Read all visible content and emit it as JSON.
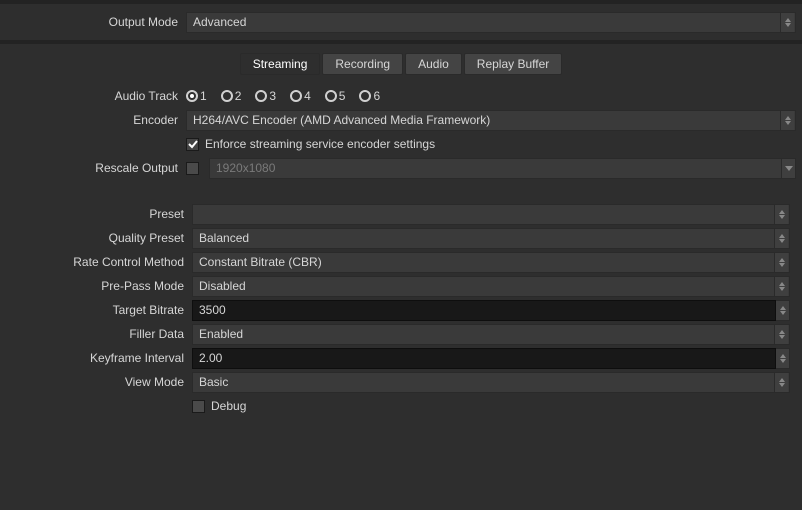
{
  "labels": {
    "output_mode": "Output Mode",
    "audio_track": "Audio Track",
    "encoder": "Encoder",
    "rescale_output": "Rescale Output",
    "preset": "Preset",
    "quality_preset": "Quality Preset",
    "rate_control_method": "Rate Control Method",
    "pre_pass_mode": "Pre-Pass Mode",
    "target_bitrate": "Target Bitrate",
    "filler_data": "Filler Data",
    "keyframe_interval": "Keyframe Interval",
    "view_mode": "View Mode"
  },
  "output_mode_value": "Advanced",
  "tabs": {
    "streaming": "Streaming",
    "recording": "Recording",
    "audio": "Audio",
    "replay_buffer": "Replay Buffer"
  },
  "audio_tracks": {
    "t1": "1",
    "t2": "2",
    "t3": "3",
    "t4": "4",
    "t5": "5",
    "t6": "6"
  },
  "encoder_value": "H264/AVC Encoder (AMD Advanced Media Framework)",
  "enforce_label": "Enforce streaming service encoder settings",
  "rescale_placeholder": "1920x1080",
  "fields": {
    "preset": "",
    "quality_preset": "Balanced",
    "rate_control_method": "Constant Bitrate (CBR)",
    "pre_pass_mode": "Disabled",
    "target_bitrate": "3500",
    "filler_data": "Enabled",
    "keyframe_interval": "2.00",
    "view_mode": "Basic"
  },
  "debug_label": "Debug"
}
